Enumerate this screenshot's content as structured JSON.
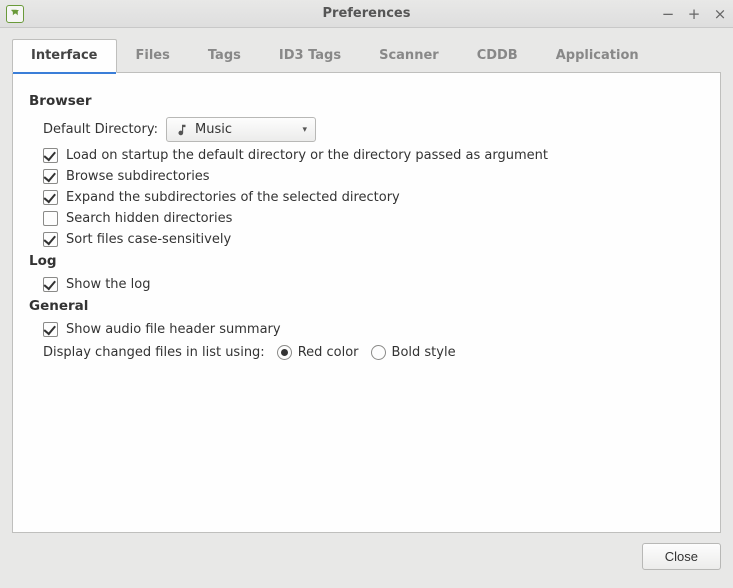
{
  "window": {
    "title": "Preferences"
  },
  "tabs": {
    "t0": "Interface",
    "t1": "Files",
    "t2": "Tags",
    "t3": "ID3 Tags",
    "t4": "Scanner",
    "t5": "CDDB",
    "t6": "Application"
  },
  "browser": {
    "heading": "Browser",
    "default_dir_label": "Default Directory:",
    "default_dir_value": "Music",
    "opt_load_on_startup": "Load on startup the default directory or the directory passed as argument",
    "opt_browse_subdirs": "Browse subdirectories",
    "opt_expand_subdirs": "Expand the subdirectories of the selected directory",
    "opt_search_hidden": "Search hidden directories",
    "opt_sort_case": "Sort files case-sensitively"
  },
  "log": {
    "heading": "Log",
    "opt_show_log": "Show the log"
  },
  "general": {
    "heading": "General",
    "opt_show_header": "Show audio file header summary",
    "display_label": "Display changed files in list using:",
    "radio_red": "Red color",
    "radio_bold": "Bold style"
  },
  "footer": {
    "close": "Close"
  }
}
